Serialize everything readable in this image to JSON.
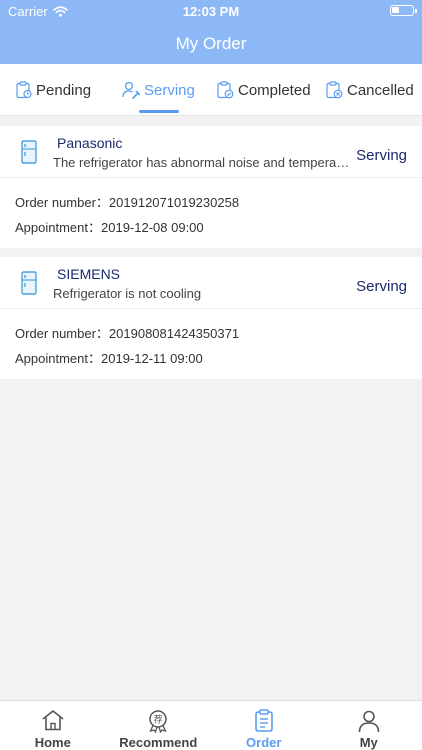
{
  "status_bar": {
    "carrier": "Carrier",
    "time": "12:03 PM"
  },
  "header": {
    "title": "My Order"
  },
  "tabs": [
    {
      "label": "Pending",
      "icon": "clipboard-clock-icon"
    },
    {
      "label": "Serving",
      "icon": "user-wrench-icon",
      "active": true
    },
    {
      "label": "Completed",
      "icon": "clipboard-check-icon"
    },
    {
      "label": "Cancelled",
      "icon": "clipboard-cancel-icon"
    }
  ],
  "orders": [
    {
      "brand": "Panasonic",
      "problem": "The refrigerator has abnormal noise and temperature",
      "status": "Serving",
      "order_number_label": "Order number：",
      "order_number": "201912071019230258",
      "appointment_label": "Appointment：",
      "appointment": "2019-12-08 09:00"
    },
    {
      "brand": "SIEMENS",
      "problem": "Refrigerator is not cooling",
      "status": "Serving",
      "order_number_label": "Order number：",
      "order_number": "201908081424350371",
      "appointment_label": "Appointment：",
      "appointment": "2019-12-11 09:00"
    }
  ],
  "bottom_nav": [
    {
      "label": "Home",
      "icon": "home-icon"
    },
    {
      "label": "Recommend",
      "icon": "recommend-badge-icon",
      "badge_char": "荐"
    },
    {
      "label": "Order",
      "icon": "order-clipboard-icon",
      "active": true
    },
    {
      "label": "My",
      "icon": "profile-icon"
    }
  ],
  "colors": {
    "header": "#8db8f6",
    "accent": "#5b9cf3",
    "status_text": "#1c2a6b"
  }
}
